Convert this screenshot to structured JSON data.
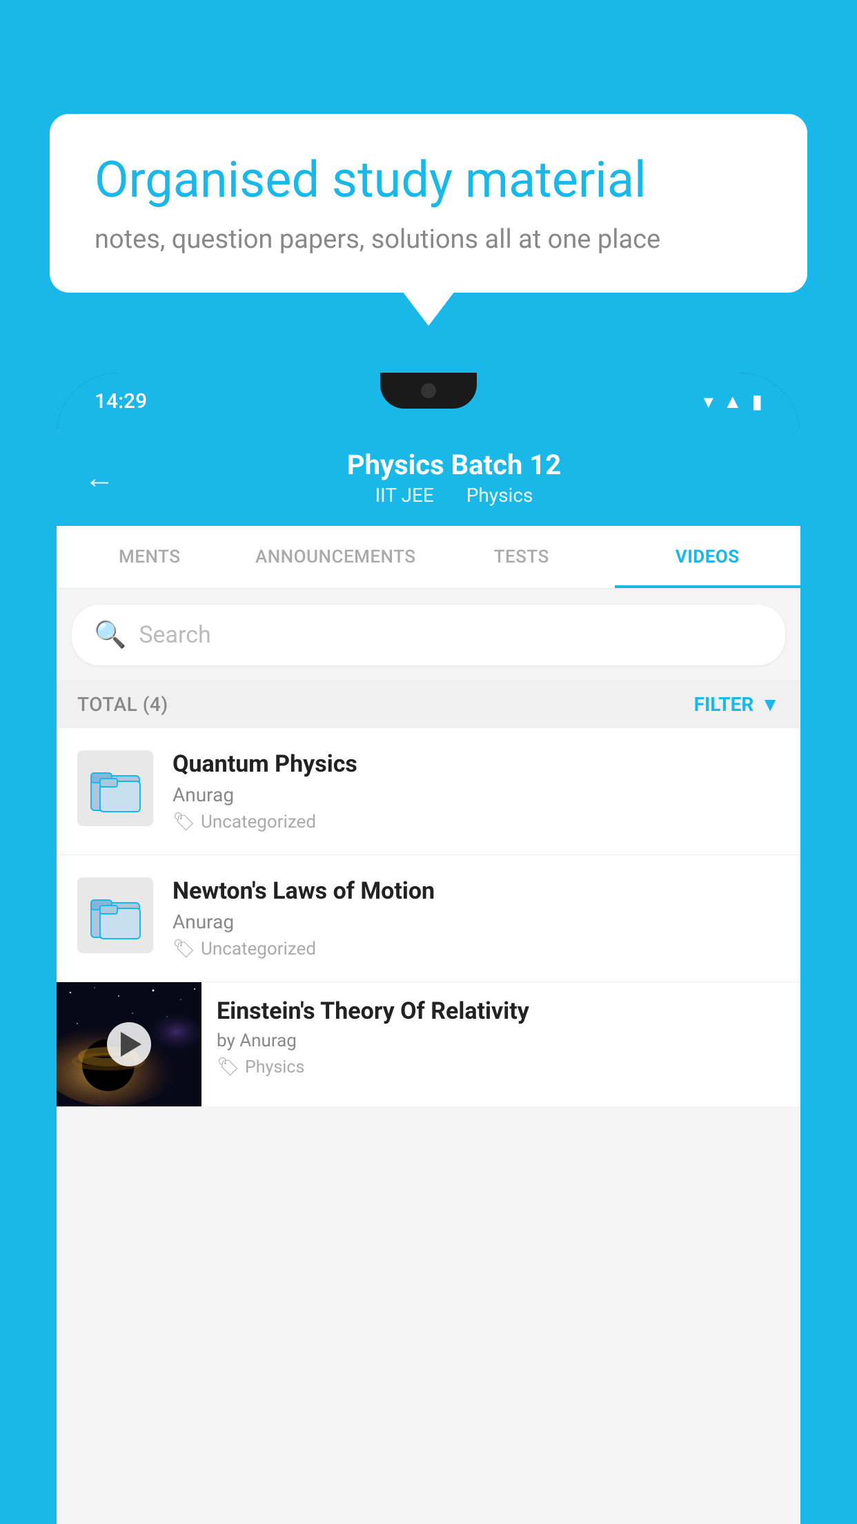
{
  "background_color": "#1ab8e8",
  "speech_bubble": {
    "title": "Organised study material",
    "subtitle": "notes, question papers, solutions all at one place"
  },
  "phone": {
    "status_bar": {
      "time": "14:29",
      "icons": [
        "wifi",
        "signal",
        "battery"
      ]
    },
    "header": {
      "title": "Physics Batch 12",
      "tag1": "IIT JEE",
      "tag2": "Physics",
      "back_label": "←"
    },
    "tabs": [
      {
        "label": "MENTS",
        "active": false
      },
      {
        "label": "ANNOUNCEMENTS",
        "active": false
      },
      {
        "label": "TESTS",
        "active": false
      },
      {
        "label": "VIDEOS",
        "active": true
      }
    ],
    "search": {
      "placeholder": "Search"
    },
    "list_header": {
      "total": "TOTAL (4)",
      "filter": "FILTER"
    },
    "videos": [
      {
        "title": "Quantum Physics",
        "author": "Anurag",
        "tag": "Uncategorized",
        "has_thumbnail": false
      },
      {
        "title": "Newton's Laws of Motion",
        "author": "Anurag",
        "tag": "Uncategorized",
        "has_thumbnail": false
      },
      {
        "title": "Einstein's Theory Of Relativity",
        "author": "by Anurag",
        "tag": "Physics",
        "has_thumbnail": true
      }
    ]
  }
}
